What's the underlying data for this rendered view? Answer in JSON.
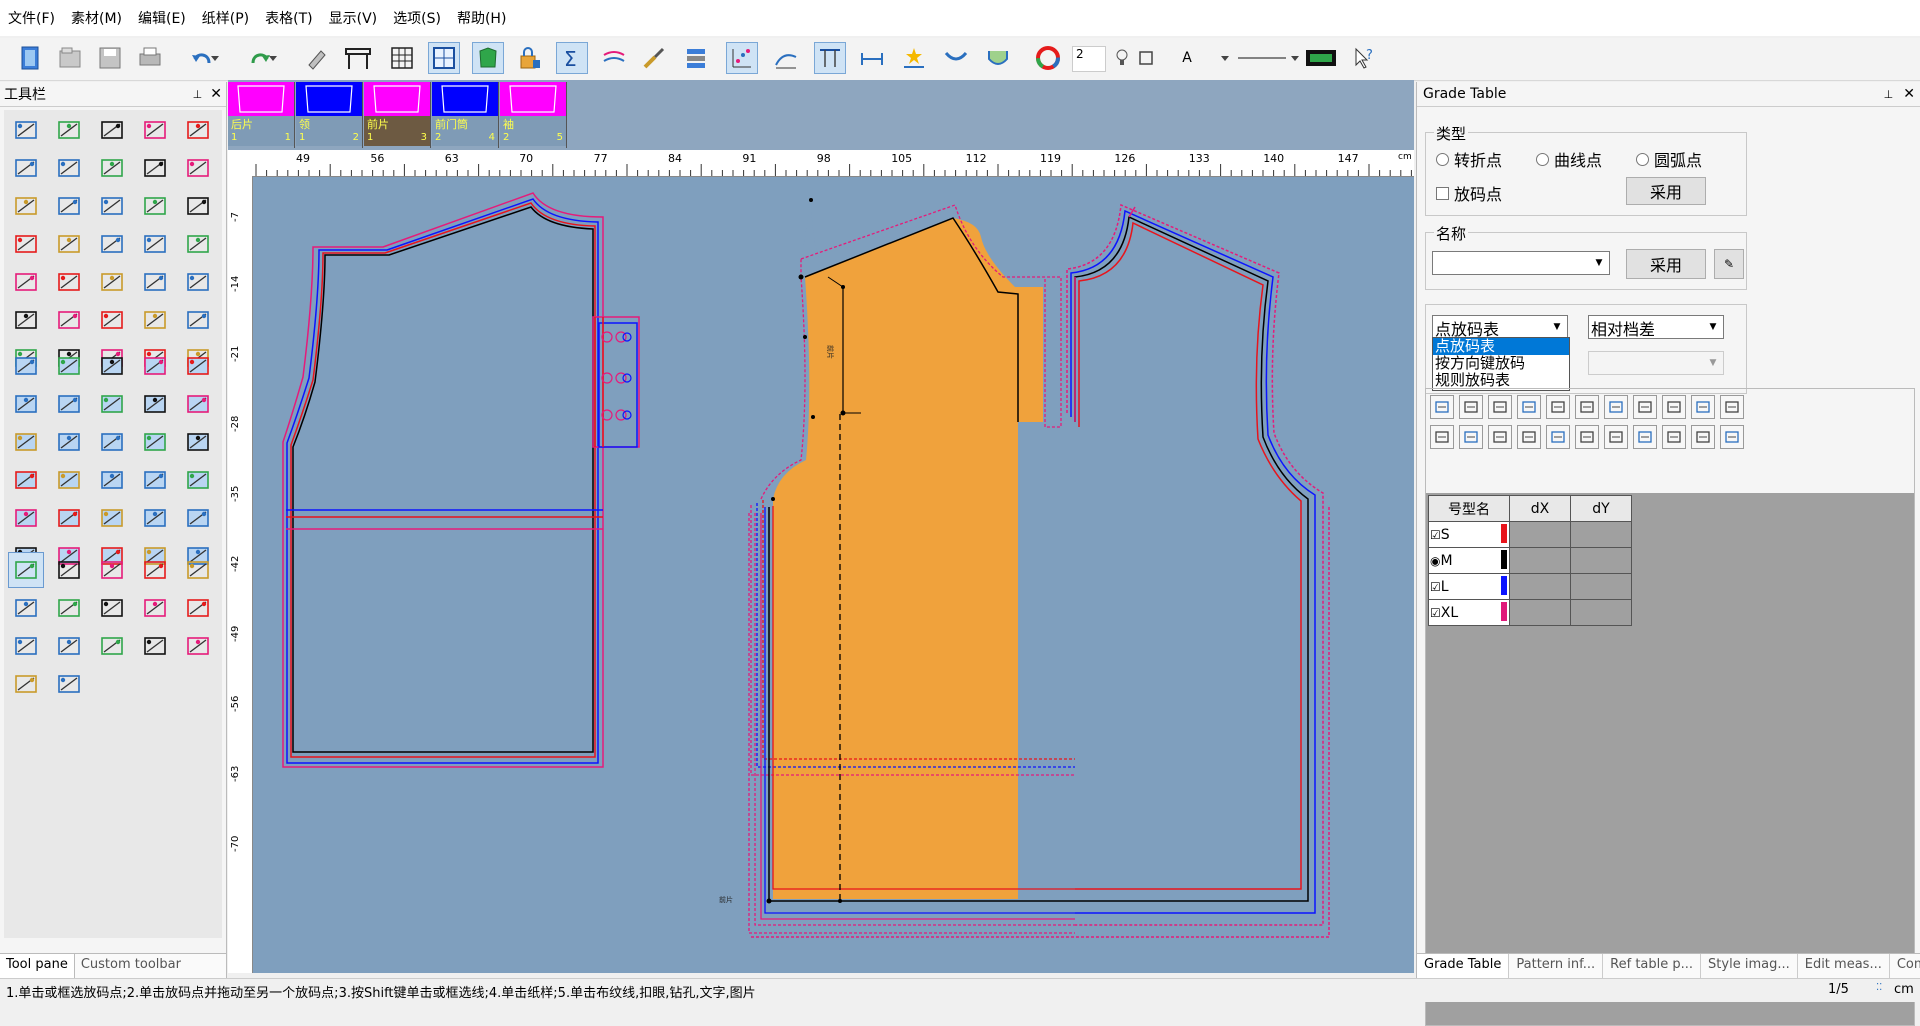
{
  "menu": [
    "文件(F)",
    "素材(M)",
    "编辑(E)",
    "纸样(P)",
    "表格(T)",
    "显示(V)",
    "选项(S)",
    "帮助(H)"
  ],
  "toolbar": {
    "line_width_value": "2",
    "text_a": "A"
  },
  "left_pane": {
    "title": "工具栏",
    "pin": "ᵖ",
    "close": "✕",
    "tabs": [
      "Tool pane",
      "Custom toolbar"
    ]
  },
  "pieces": [
    {
      "name": "后片",
      "qty": "1",
      "num": "1",
      "color": "#ff00ff"
    },
    {
      "name": "领",
      "qty": "1",
      "num": "2",
      "color": "#0000ff"
    },
    {
      "name": "前片",
      "qty": "1",
      "num": "3",
      "color": "#ff00ff"
    },
    {
      "name": "前门筒",
      "qty": "2",
      "num": "4",
      "color": "#0000ff"
    },
    {
      "name": "袖",
      "qty": "2",
      "num": "5",
      "color": "#ff00ff"
    }
  ],
  "ruler": {
    "top": [
      "49",
      "56",
      "63",
      "70",
      "77",
      "84",
      "91",
      "98",
      "105",
      "112",
      "119",
      "126",
      "133",
      "140",
      "147"
    ],
    "unit": "cm",
    "left": [
      "-7",
      "-14",
      "-21",
      "-28",
      "-35",
      "-42",
      "-49",
      "-56",
      "-63",
      "-70"
    ]
  },
  "canvas_labels": {
    "front_fold": "前片",
    "grainline": "前片"
  },
  "grade_table": {
    "title": "Grade Table",
    "type_group": "类型",
    "radios": [
      "转折点",
      "曲线点",
      "圆弧点"
    ],
    "checkbox_label": "放码点",
    "apply": "采用",
    "name_group": "名称",
    "name_value": "",
    "mode_select": "点放码表",
    "mode_options": [
      "点放码表",
      "按方向键放码",
      "规则放码表"
    ],
    "diff_select": "相对档差",
    "headers": [
      "号型名",
      "dX",
      "dY"
    ],
    "sizes": [
      {
        "name": "S",
        "color": "#e8141b",
        "checked": "☑"
      },
      {
        "name": "M",
        "color": "#000000",
        "checked": "◉"
      },
      {
        "name": "L",
        "color": "#0b14ff",
        "checked": "☑"
      },
      {
        "name": "XL",
        "color": "#e0197a",
        "checked": "☑"
      }
    ],
    "tabs": [
      "Grade Table",
      "Pattern inf...",
      "Ref table p...",
      "Style imag...",
      "Edit meas...",
      "Compare ..."
    ]
  },
  "status": {
    "hint": "1.单击或框选放码点;2.单击放码点并拖动至另一个放码点;3.按Shift键单击或框选线;4.单击纸样;5.单击布纹线,扣眼,钻孔,文字,图片",
    "page": "1/5",
    "unit": "cm"
  },
  "colors": {
    "fill": "#f0a23c",
    "canvas": "#7f9fbe",
    "s": "#e8141b",
    "m": "#000000",
    "l": "#0b14ff",
    "xl": "#e0197a"
  }
}
